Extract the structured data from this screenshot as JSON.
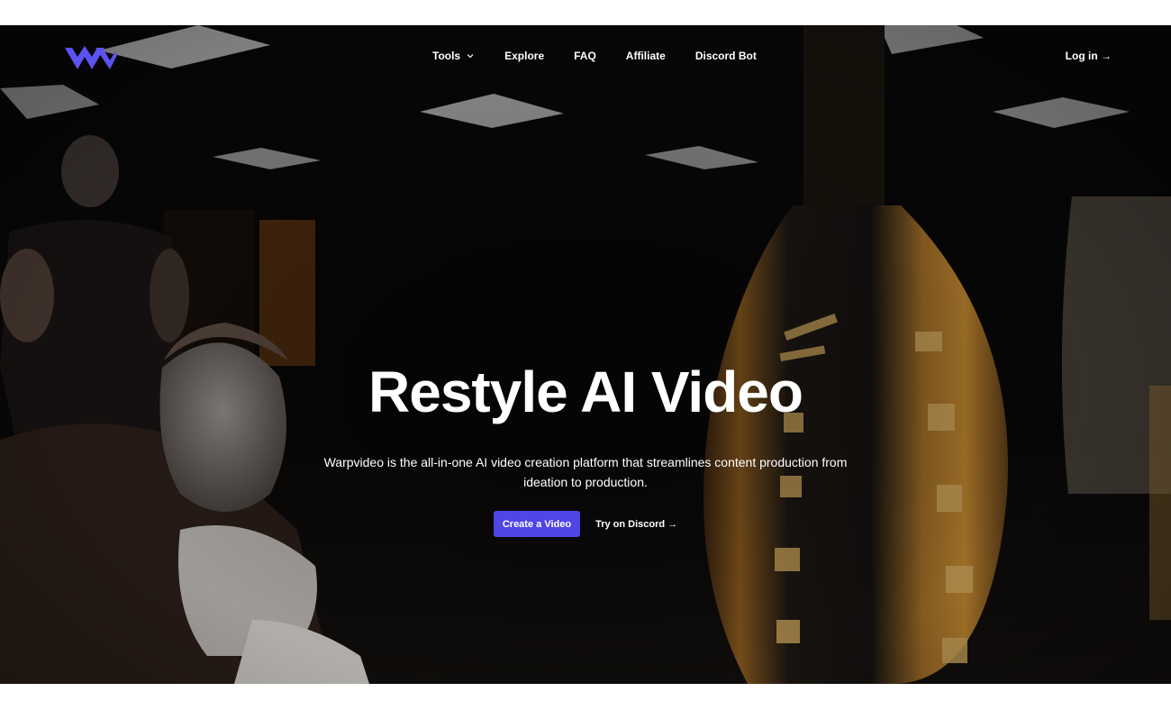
{
  "header": {
    "logo_icon": "warpvideo-w-logo",
    "nav": [
      {
        "label": "Tools",
        "has_dropdown": true
      },
      {
        "label": "Explore"
      },
      {
        "label": "FAQ"
      },
      {
        "label": "Affiliate"
      },
      {
        "label": "Discord Bot"
      }
    ],
    "login_label": "Log in →"
  },
  "hero": {
    "title": "Restyle AI Video",
    "subtitle": "Warpvideo is the all-in-one AI video creation platform that streamlines content production from ideation to production.",
    "primary_cta": "Create a Video",
    "secondary_cta": "Try on Discord →"
  },
  "colors": {
    "accent": "#4f46e5",
    "logo": "#5b52f0",
    "text": "#ffffff",
    "background": "#070606"
  }
}
